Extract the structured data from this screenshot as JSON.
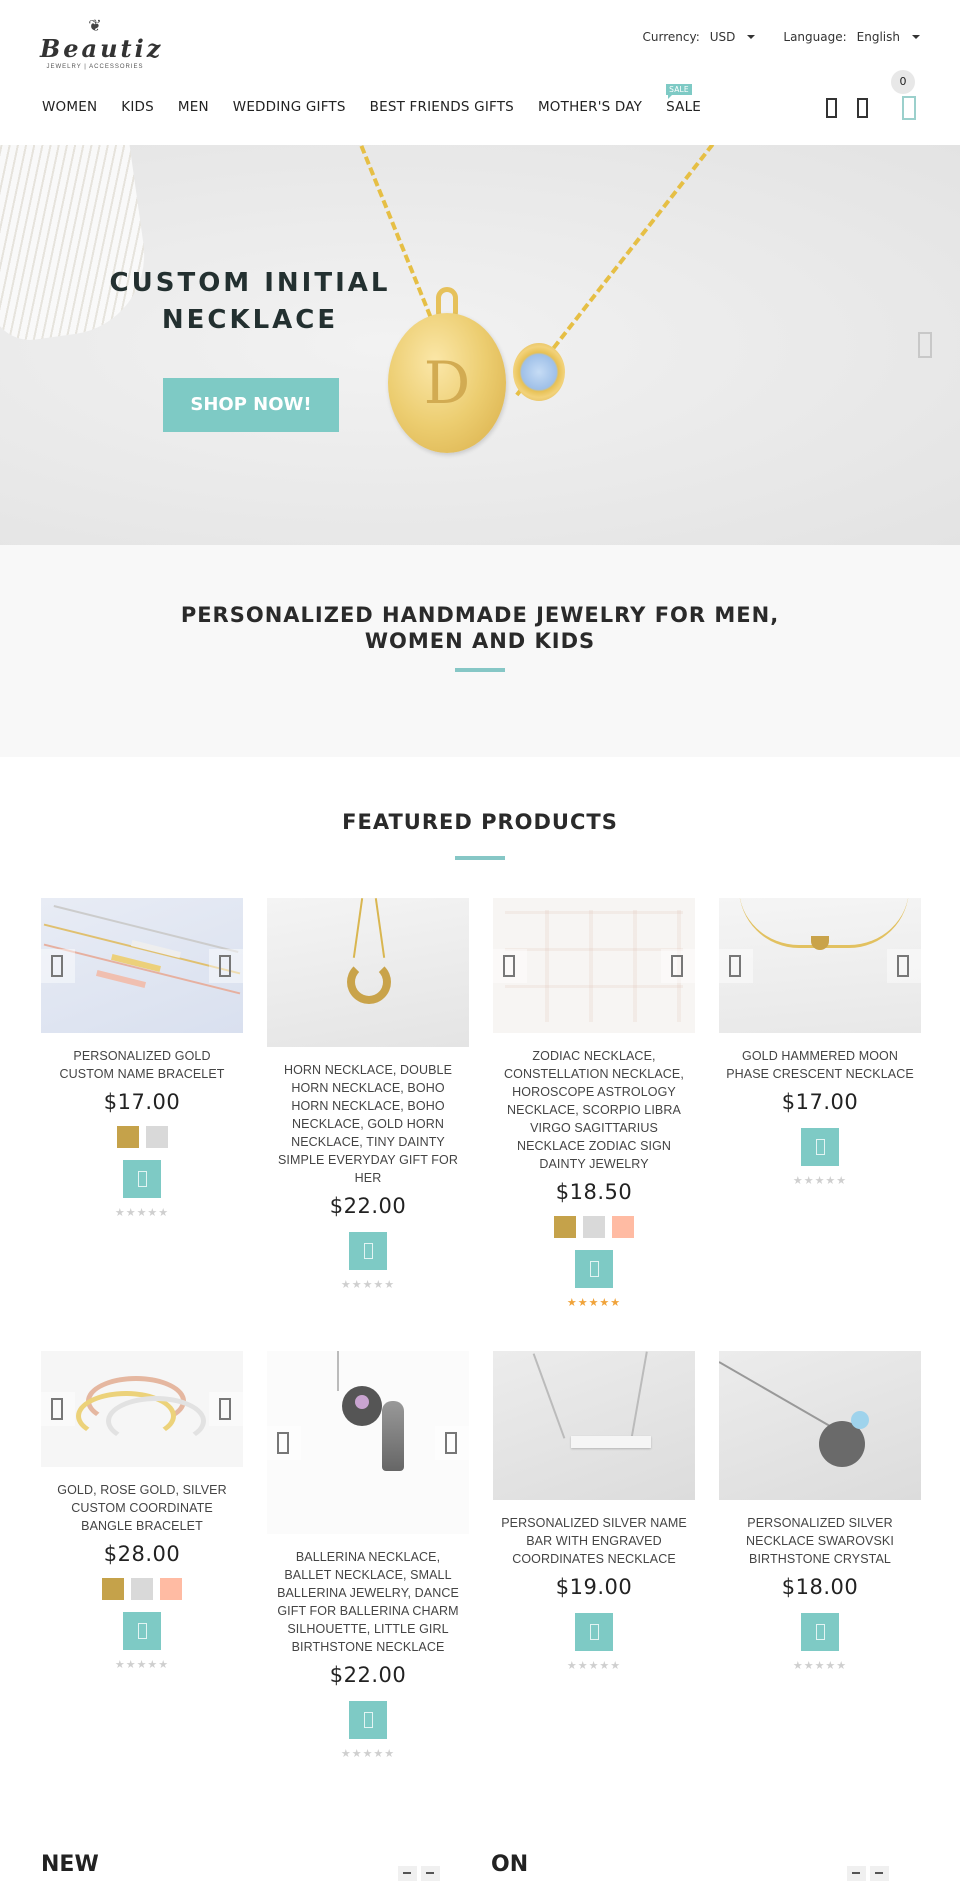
{
  "header": {
    "logo": {
      "name": "Beautiz",
      "tagline": "JEWELRY | ACCESSORIES",
      "emblem": "❦"
    },
    "currency": {
      "label": "Currency:",
      "value": "USD"
    },
    "language": {
      "label": "Language:",
      "value": "English"
    },
    "nav": [
      {
        "label": "WOMEN"
      },
      {
        "label": "KIDS"
      },
      {
        "label": "MEN"
      },
      {
        "label": "WEDDING GIFTS"
      },
      {
        "label": "BEST FRIENDS GIFTS"
      },
      {
        "label": "MOTHER'S DAY"
      },
      {
        "label": "SALE",
        "badge": "SALE"
      }
    ],
    "icons": [
      "user-icon",
      "heart-icon",
      "cart-icon"
    ],
    "cart_count": "0"
  },
  "hero": {
    "title": "CUSTOM INITIAL NECKLACE",
    "pendant_letter": "D",
    "button": "SHOP NOW!"
  },
  "intro": {
    "title": "PERSONALIZED HANDMADE JEWELRY FOR MEN, WOMEN AND KIDS"
  },
  "featured": {
    "title": "FEATURED PRODUCTS",
    "products": [
      {
        "name": "PERSONALIZED GOLD CUSTOM NAME BRACELET",
        "price": "$17.00",
        "swatches": [
          "#c5a24a",
          "#d9d9d9"
        ],
        "stars": "★★★★★",
        "rating": 0
      },
      {
        "name": "HORN NECKLACE, DOUBLE HORN NECKLACE, BOHO HORN NECKLACE, BOHO NECKLACE, GOLD HORN NECKLACE, TINY DAINTY SIMPLE EVERYDAY GIFT FOR HER",
        "price": "$22.00",
        "swatches": [],
        "stars": "★★★★★",
        "rating": 0
      },
      {
        "name": "ZODIAC NECKLACE, CONSTELLATION NECKLACE, HOROSCOPE ASTROLOGY NECKLACE, SCORPIO LIBRA VIRGO SAGITTARIUS NECKLACE ZODIAC SIGN DAINTY JEWELRY",
        "price": "$18.50",
        "swatches": [
          "#c5a24a",
          "#d9d9d9",
          "#ffbba3"
        ],
        "stars": "★★★★★",
        "rating": 5
      },
      {
        "name": "GOLD HAMMERED MOON PHASE CRESCENT NECKLACE",
        "price": "$17.00",
        "swatches": [],
        "stars": "★★★★★",
        "rating": 0
      },
      {
        "name": "GOLD, ROSE GOLD, SILVER CUSTOM COORDINATE BANGLE BRACELET",
        "price": "$28.00",
        "swatches": [
          "#c5a24a",
          "#d9d9d9",
          "#ffbba3"
        ],
        "stars": "★★★★★",
        "rating": 0
      },
      {
        "name": "BALLERINA NECKLACE, BALLET NECKLACE, SMALL BALLERINA JEWELRY, DANCE GIFT FOR BALLERINA CHARM SILHOUETTE, LITTLE GIRL BIRTHSTONE NECKLACE",
        "price": "$22.00",
        "swatches": [],
        "stars": "★★★★★",
        "rating": 0
      },
      {
        "name": "PERSONALIZED SILVER NAME BAR WITH ENGRAVED COORDINATES NECKLACE",
        "price": "$19.00",
        "swatches": [],
        "stars": "★★★★★",
        "rating": 0
      },
      {
        "name": "PERSONALIZED SILVER NECKLACE SWAROVSKI BIRTHSTONE CRYSTAL",
        "price": "$18.00",
        "swatches": [],
        "stars": "★★★★★",
        "rating": 0
      }
    ]
  },
  "bottom": {
    "left_title": "NEW",
    "right_title": "ON"
  },
  "colors": {
    "accent": "#7ecac5",
    "underline": "#86c7c6",
    "star_rated": "#f0a33a",
    "star_empty": "#cfcfcf"
  }
}
